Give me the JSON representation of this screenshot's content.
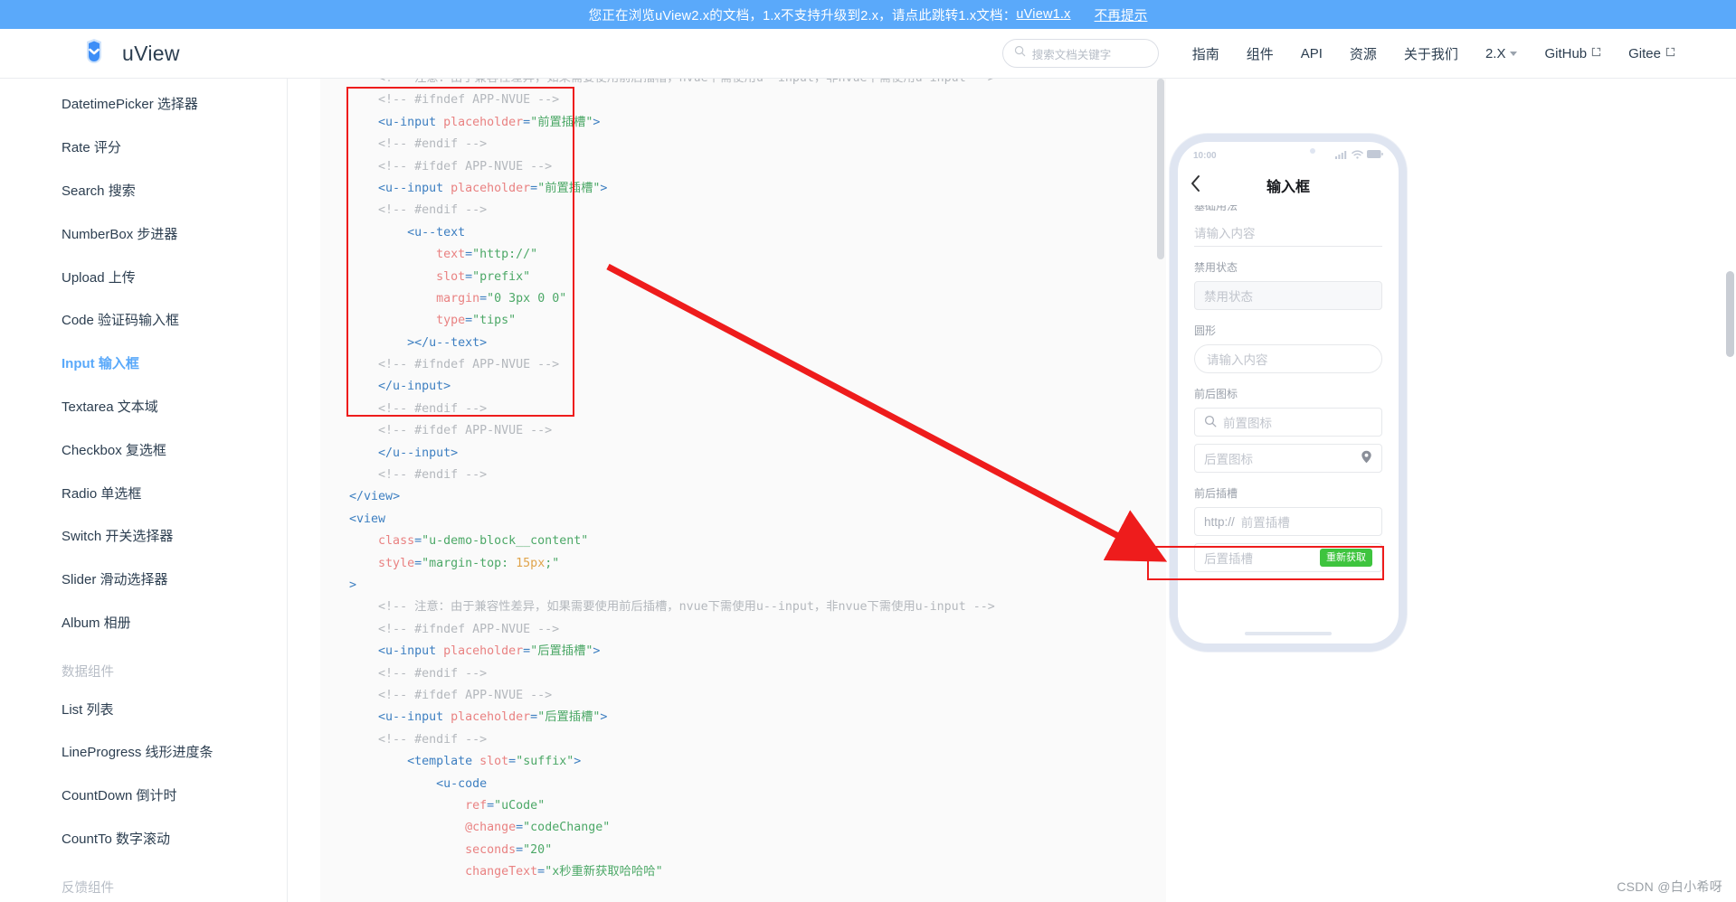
{
  "promo": {
    "text": "您正在浏览uView2.x的文档，1.x不支持升级到2.x，请点此跳转1.x文档：",
    "link_label": "uView1.x",
    "dismiss_label": "不再提示"
  },
  "header": {
    "brand": "uView",
    "search_placeholder": "搜索文档关键字",
    "nav": [
      {
        "label": "指南",
        "external": false,
        "dropdown": false
      },
      {
        "label": "组件",
        "external": false,
        "dropdown": false
      },
      {
        "label": "API",
        "external": false,
        "dropdown": false
      },
      {
        "label": "资源",
        "external": false,
        "dropdown": false
      },
      {
        "label": "关于我们",
        "external": false,
        "dropdown": false
      },
      {
        "label": "2.X",
        "external": false,
        "dropdown": true
      },
      {
        "label": "GitHub",
        "external": true,
        "dropdown": false
      },
      {
        "label": "Gitee",
        "external": true,
        "dropdown": false
      }
    ]
  },
  "sidebar": {
    "items": [
      {
        "label": "DatetimePicker 选择器",
        "type": "item",
        "active": false
      },
      {
        "label": "Rate 评分",
        "type": "item",
        "active": false
      },
      {
        "label": "Search 搜索",
        "type": "item",
        "active": false
      },
      {
        "label": "NumberBox 步进器",
        "type": "item",
        "active": false
      },
      {
        "label": "Upload 上传",
        "type": "item",
        "active": false
      },
      {
        "label": "Code 验证码输入框",
        "type": "item",
        "active": false
      },
      {
        "label": "Input 输入框",
        "type": "item",
        "active": true
      },
      {
        "label": "Textarea 文本域",
        "type": "item",
        "active": false
      },
      {
        "label": "Checkbox 复选框",
        "type": "item",
        "active": false
      },
      {
        "label": "Radio 单选框",
        "type": "item",
        "active": false
      },
      {
        "label": "Switch 开关选择器",
        "type": "item",
        "active": false
      },
      {
        "label": "Slider 滑动选择器",
        "type": "item",
        "active": false
      },
      {
        "label": "Album 相册",
        "type": "item",
        "active": false
      },
      {
        "label": "数据组件",
        "type": "group",
        "active": false
      },
      {
        "label": "List 列表",
        "type": "item",
        "active": false
      },
      {
        "label": "LineProgress 线形进度条",
        "type": "item",
        "active": false
      },
      {
        "label": "CountDown 倒计时",
        "type": "item",
        "active": false
      },
      {
        "label": "CountTo 数字滚动",
        "type": "item",
        "active": false
      },
      {
        "label": "反馈组件",
        "type": "group",
        "active": false
      }
    ]
  },
  "code": {
    "language": "vue-html",
    "lines": [
      {
        "indent": 2,
        "segs": [
          {
            "t": "cmt",
            "v": "<!-- 注意：由于兼容性差异，如果需要使用前后插槽，nvue下需使用u--input，非nvue下需使用u-input -->"
          }
        ]
      },
      {
        "indent": 2,
        "segs": [
          {
            "t": "cmt",
            "v": "<!-- #ifndef APP-NVUE -->"
          }
        ]
      },
      {
        "indent": 2,
        "segs": [
          {
            "t": "tag",
            "v": "<u-input "
          },
          {
            "t": "attr",
            "v": "placeholder"
          },
          {
            "t": "punc",
            "v": "="
          },
          {
            "t": "str",
            "v": "\"前置插槽\""
          },
          {
            "t": "tag",
            "v": ">"
          }
        ]
      },
      {
        "indent": 2,
        "segs": [
          {
            "t": "cmt",
            "v": "<!-- #endif -->"
          }
        ]
      },
      {
        "indent": 2,
        "segs": [
          {
            "t": "cmt",
            "v": "<!-- #ifdef APP-NVUE -->"
          }
        ]
      },
      {
        "indent": 2,
        "segs": [
          {
            "t": "tag",
            "v": "<u--input "
          },
          {
            "t": "attr",
            "v": "placeholder"
          },
          {
            "t": "punc",
            "v": "="
          },
          {
            "t": "str",
            "v": "\"前置插槽\""
          },
          {
            "t": "tag",
            "v": ">"
          }
        ]
      },
      {
        "indent": 2,
        "segs": [
          {
            "t": "cmt",
            "v": "<!-- #endif -->"
          }
        ]
      },
      {
        "indent": 3,
        "segs": [
          {
            "t": "tag",
            "v": "<u--text"
          }
        ]
      },
      {
        "indent": 4,
        "segs": [
          {
            "t": "attr",
            "v": "text"
          },
          {
            "t": "punc",
            "v": "="
          },
          {
            "t": "str",
            "v": "\"http://\""
          }
        ]
      },
      {
        "indent": 4,
        "segs": [
          {
            "t": "attr",
            "v": "slot"
          },
          {
            "t": "punc",
            "v": "="
          },
          {
            "t": "str",
            "v": "\"prefix\""
          }
        ]
      },
      {
        "indent": 4,
        "segs": [
          {
            "t": "attr",
            "v": "margin"
          },
          {
            "t": "punc",
            "v": "="
          },
          {
            "t": "str",
            "v": "\"0 3px 0 0\""
          }
        ]
      },
      {
        "indent": 4,
        "segs": [
          {
            "t": "attr",
            "v": "type"
          },
          {
            "t": "punc",
            "v": "="
          },
          {
            "t": "str",
            "v": "\"tips\""
          }
        ]
      },
      {
        "indent": 3,
        "segs": [
          {
            "t": "tag",
            "v": "></u--text>"
          }
        ]
      },
      {
        "indent": 2,
        "segs": [
          {
            "t": "cmt",
            "v": "<!-- #ifndef APP-NVUE -->"
          }
        ]
      },
      {
        "indent": 2,
        "segs": [
          {
            "t": "tag",
            "v": "</u-input>"
          }
        ]
      },
      {
        "indent": 2,
        "segs": [
          {
            "t": "cmt",
            "v": "<!-- #endif -->"
          }
        ]
      },
      {
        "indent": 2,
        "segs": [
          {
            "t": "cmt",
            "v": "<!-- #ifdef APP-NVUE -->"
          }
        ]
      },
      {
        "indent": 2,
        "segs": [
          {
            "t": "tag",
            "v": "</u--input>"
          }
        ]
      },
      {
        "indent": 2,
        "segs": [
          {
            "t": "cmt",
            "v": "<!-- #endif -->"
          }
        ]
      },
      {
        "indent": 1,
        "segs": [
          {
            "t": "tag",
            "v": "</view>"
          }
        ]
      },
      {
        "indent": 1,
        "segs": [
          {
            "t": "tag",
            "v": "<view"
          }
        ]
      },
      {
        "indent": 2,
        "segs": [
          {
            "t": "attr",
            "v": "class"
          },
          {
            "t": "punc",
            "v": "="
          },
          {
            "t": "str",
            "v": "\"u-demo-block__content\""
          }
        ]
      },
      {
        "indent": 2,
        "segs": [
          {
            "t": "attr",
            "v": "style"
          },
          {
            "t": "punc",
            "v": "="
          },
          {
            "t": "str",
            "v": "\"margin-top: "
          },
          {
            "t": "num",
            "v": "15px"
          },
          {
            "t": "str",
            "v": ";\""
          }
        ]
      },
      {
        "indent": 1,
        "segs": [
          {
            "t": "tag",
            "v": ">"
          }
        ]
      },
      {
        "indent": 2,
        "segs": [
          {
            "t": "cmt",
            "v": "<!-- 注意：由于兼容性差异，如果需要使用前后插槽，nvue下需使用u--input，非nvue下需使用u-input -->"
          }
        ]
      },
      {
        "indent": 2,
        "segs": [
          {
            "t": "cmt",
            "v": "<!-- #ifndef APP-NVUE -->"
          }
        ]
      },
      {
        "indent": 2,
        "segs": [
          {
            "t": "tag",
            "v": "<u-input "
          },
          {
            "t": "attr",
            "v": "placeholder"
          },
          {
            "t": "punc",
            "v": "="
          },
          {
            "t": "str",
            "v": "\"后置插槽\""
          },
          {
            "t": "tag",
            "v": ">"
          }
        ]
      },
      {
        "indent": 2,
        "segs": [
          {
            "t": "cmt",
            "v": "<!-- #endif -->"
          }
        ]
      },
      {
        "indent": 2,
        "segs": [
          {
            "t": "cmt",
            "v": "<!-- #ifdef APP-NVUE -->"
          }
        ]
      },
      {
        "indent": 2,
        "segs": [
          {
            "t": "tag",
            "v": "<u--input "
          },
          {
            "t": "attr",
            "v": "placeholder"
          },
          {
            "t": "punc",
            "v": "="
          },
          {
            "t": "str",
            "v": "\"后置插槽\""
          },
          {
            "t": "tag",
            "v": ">"
          }
        ]
      },
      {
        "indent": 2,
        "segs": [
          {
            "t": "cmt",
            "v": "<!-- #endif -->"
          }
        ]
      },
      {
        "indent": 3,
        "segs": [
          {
            "t": "tag",
            "v": "<template "
          },
          {
            "t": "attr",
            "v": "slot"
          },
          {
            "t": "punc",
            "v": "="
          },
          {
            "t": "str",
            "v": "\"suffix\""
          },
          {
            "t": "tag",
            "v": ">"
          }
        ]
      },
      {
        "indent": 4,
        "segs": [
          {
            "t": "tag",
            "v": "<u-code"
          }
        ]
      },
      {
        "indent": 5,
        "segs": [
          {
            "t": "attr",
            "v": "ref"
          },
          {
            "t": "punc",
            "v": "="
          },
          {
            "t": "str",
            "v": "\"uCode\""
          }
        ]
      },
      {
        "indent": 5,
        "segs": [
          {
            "t": "attr",
            "v": "@change"
          },
          {
            "t": "punc",
            "v": "="
          },
          {
            "t": "str",
            "v": "\"codeChange\""
          }
        ]
      },
      {
        "indent": 5,
        "segs": [
          {
            "t": "attr",
            "v": "seconds"
          },
          {
            "t": "punc",
            "v": "="
          },
          {
            "t": "str",
            "v": "\"20\""
          }
        ]
      },
      {
        "indent": 5,
        "segs": [
          {
            "t": "attr",
            "v": "changeText"
          },
          {
            "t": "punc",
            "v": "="
          },
          {
            "t": "str",
            "v": "\"x秒重新获取哈哈哈\""
          }
        ]
      }
    ]
  },
  "phone": {
    "status_time": "10:00",
    "nav_title": "输入框",
    "back_icon": "chevron-left-icon",
    "clipped_label": "基础用法",
    "sections": [
      {
        "label": "",
        "placeholder": "请输入内容",
        "style": "line",
        "clipped": true
      },
      {
        "label": "禁用状态",
        "placeholder": "禁用状态",
        "style": "box-disabled"
      },
      {
        "label": "圆形",
        "placeholder": "请输入内容",
        "style": "round"
      },
      {
        "label": "前后图标",
        "placeholder": "前置图标",
        "style": "box",
        "prefix_icon": "search-icon"
      },
      {
        "label": "",
        "placeholder": "后置图标",
        "style": "box",
        "suffix_icon": "map-pin-icon"
      },
      {
        "label": "前后插槽",
        "placeholder": "前置插槽",
        "style": "box",
        "prefix_text": "http://",
        "highlighted": true
      },
      {
        "label": "",
        "placeholder": "后置插槽",
        "style": "box",
        "suffix_button": "重新获取"
      }
    ]
  },
  "watermark": "CSDN @白小希呀",
  "colors": {
    "accent": "#5aa9fa",
    "highlight": "#ee1c1c",
    "code_bg": "#fafafa",
    "green_button": "#3ec43e"
  }
}
